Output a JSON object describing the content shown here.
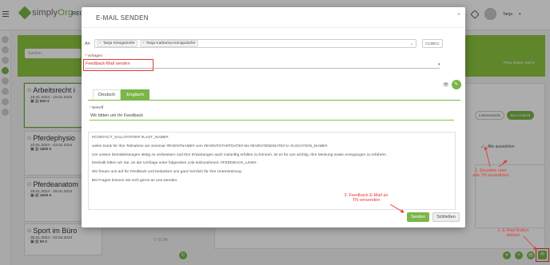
{
  "app": {
    "logo_text_1": "simply",
    "logo_text_2": "Org",
    "nav_partial": "REC",
    "user_name": "Tanja"
  },
  "background": {
    "search_placeholder": "Suchen",
    "price_label": "Preis (netto): 600 €",
    "view_buttons": [
      "Listenansicht",
      "Box-Ansicht"
    ],
    "select_all": "Alle auswählen",
    "seminars": [
      {
        "title": "Arbeitsrecht i",
        "dates": "18.01.2024 - 19.01.2024",
        "price": "600 €",
        "selected": true
      },
      {
        "title": "Pferdephysio",
        "dates": "22.01.2024 - 23.01.2024",
        "price": "1800 €",
        "selected": false
      },
      {
        "title": "Pferdeanatom",
        "dates": "29.01.2024 - 29.01.2024",
        "price": "1500 €",
        "selected": false
      },
      {
        "title": "Sport im Büro",
        "dates": "30.01.2024 - 02.02.2024",
        "price": "50 €",
        "selected": false
      }
    ],
    "count_badge": "0 24"
  },
  "modal": {
    "title": "E-MAIL SENDEN",
    "to_label": "An",
    "recipients": [
      "Tanja Königsdorfer",
      "Tanja Katharina Königsdorfer"
    ],
    "cc_label": "CC/BCC",
    "vorlagen_label": "Vorlagen",
    "vorlagen_value": "Feedback-Mail senden",
    "tabs": [
      "Deutsch",
      "Englisch"
    ],
    "active_tab": "Englisch",
    "subject_label": "Betreff",
    "subject_value": "Wir bitten um Ihr Feedback",
    "body_lines": [
      "#CONTACT_SALUTATION# #LAST_NAME#,",
      "vielen Dank für Ihre Teilnahme am Seminar #EVENTNAME# vom #EVENTSTARTDATE# bis #EVENTENDDATE# in #LOCATION_NAME#.",
      "Um unsere Dienstleistungen stetig zu verbessern und Ihre Erwartungen auch zukünftig erfüllen zu können, ist es für uns wichtig, Ihre Meinung sowie Anregungen zu erfahren.",
      "Deshalb bitten wir Sie, an der Umfrage unter folgendem Link teilzunehmen: #FEEDBACK_LINK#.",
      "Wir freuen uns auf Ihr Feedback und bedanken uns ganz herzlich für Ihre Unterstützung.",
      "Bei Fragen können Sie sich gerne an uns wenden."
    ],
    "send_label": "Senden",
    "close_label": "Schließen"
  },
  "annotations": {
    "step1": "1. Einzelne oder alle TN auswählen",
    "step2": "2. E-Mail Button klicken",
    "step3": "3. Feedback E-Mail an TN versenden"
  },
  "colors": {
    "brand_green": "#7ab648",
    "annotation_red": "#e53935"
  },
  "icons": [
    "hamburger-icon",
    "logo-icon",
    "tag-icon",
    "avatar",
    "close-icon",
    "eye-icon",
    "toggle-icon",
    "mail-icon",
    "check-icon"
  ]
}
